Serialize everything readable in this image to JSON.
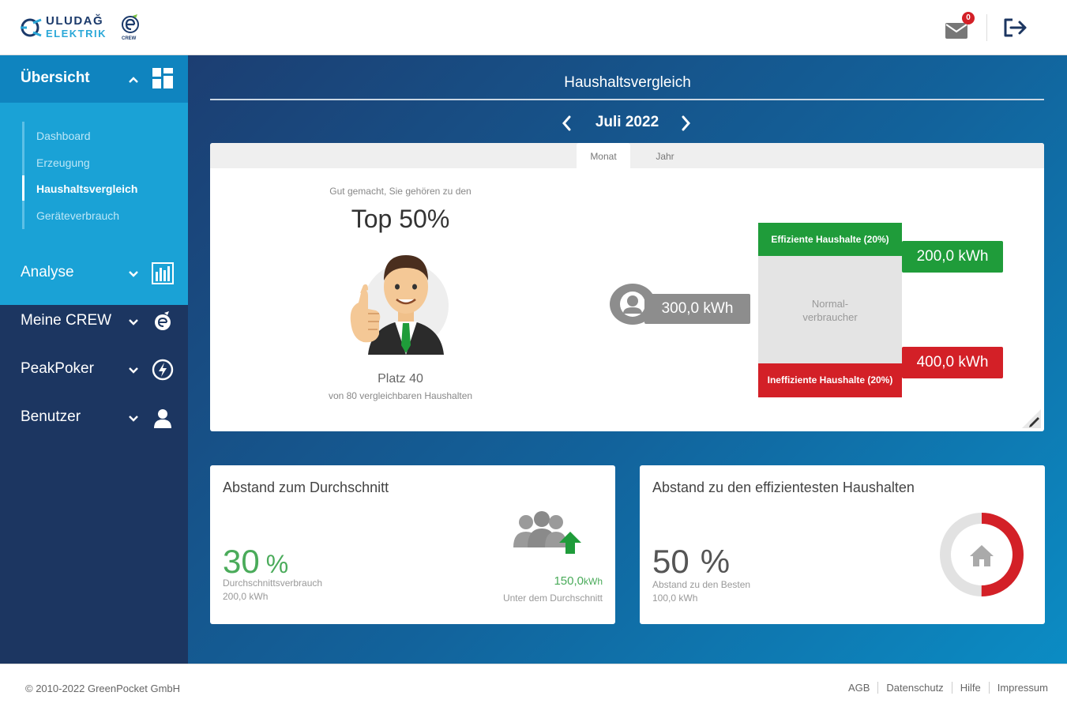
{
  "header": {
    "logo_line1": "ULUDAĞ",
    "logo_line2": "ELEKTRIK",
    "logo_tag": "CREW",
    "mail_badge": "0",
    "icons": {
      "mail": "mail-icon",
      "logout": "logout-icon"
    }
  },
  "sidebar": {
    "main": {
      "label": "Übersicht",
      "icon": "dashboard-grid-icon"
    },
    "subitems": [
      {
        "label": "Dashboard"
      },
      {
        "label": "Erzeugung"
      },
      {
        "label": "Haushaltsvergleich",
        "active": true
      },
      {
        "label": "Geräteverbrauch"
      }
    ],
    "items": [
      {
        "label": "Analyse",
        "icon": "bar-chart-icon"
      },
      {
        "label": "Meine CREW",
        "icon": "crew-icon"
      },
      {
        "label": "PeakPoker",
        "icon": "lightning-icon"
      },
      {
        "label": "Benutzer",
        "icon": "user-icon"
      }
    ]
  },
  "main": {
    "title": "Haushaltsvergleich",
    "month": "Juli 2022",
    "tabs": [
      {
        "label": "Monat",
        "active": true
      },
      {
        "label": "Jahr",
        "active": false
      }
    ],
    "ranking": {
      "intro": "Gut gemacht, Sie gehören zu den",
      "top": "Top 50%",
      "platz": "Platz 40",
      "platz_sub": "von 80 vergleichbaren Haushalten"
    },
    "comparison": {
      "user_value": "300,0 kWh",
      "efficient_label": "Effiziente Haushalte (20%)",
      "efficient_value": "200,0 kWh",
      "normal_label": "Normal-verbraucher",
      "inefficient_label": "Ineffiziente Haushalte (20%)",
      "inefficient_value": "400,0 kWh"
    },
    "avg_card": {
      "title": "Abstand zum Durchschnitt",
      "value": "30",
      "unit": "%",
      "label1": "Durchschnittsverbrauch",
      "label2": "200,0 kWh",
      "right_value": "150,0",
      "right_unit": "kWh",
      "right_label": "Unter dem Durchschnitt"
    },
    "eff_card": {
      "title": "Abstand zu den effizientesten Haushalten",
      "value": "50",
      "unit": "%",
      "label1": "Abstand zu den Besten",
      "label2": "100,0 kWh",
      "donut_fraction": 0.5
    }
  },
  "colors": {
    "green": "#1f9c3a",
    "red": "#d32027",
    "sidebar": "#1c3661",
    "accent": "#1aa2d6"
  },
  "footer": {
    "copyright": "© 2010-2022 GreenPocket GmbH",
    "links": [
      "AGB",
      "Datenschutz",
      "Hilfe",
      "Impressum"
    ]
  }
}
